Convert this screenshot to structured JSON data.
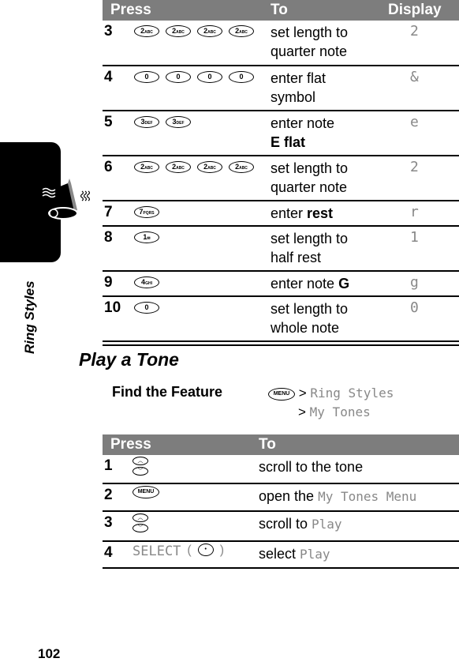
{
  "section_tab": {
    "label": "Ring Styles",
    "icon": "ringing-bell-icon"
  },
  "table1": {
    "headers": {
      "press": "Press",
      "to": "To",
      "display": "Display"
    },
    "rows": [
      {
        "step": "3",
        "keys": [
          [
            "2",
            "ABC"
          ],
          [
            "2",
            "ABC"
          ],
          [
            "2",
            "ABC"
          ],
          [
            "2",
            "ABC"
          ]
        ],
        "to_line1": "set length to",
        "to_line2": "quarter note",
        "display": "2"
      },
      {
        "step": "4",
        "keys": [
          [
            "0",
            ""
          ],
          [
            "0",
            ""
          ],
          [
            "0",
            ""
          ],
          [
            "0",
            ""
          ]
        ],
        "to_line1": "enter flat",
        "to_line2": "symbol",
        "display": "&"
      },
      {
        "step": "5",
        "keys": [
          [
            "3",
            "DEF"
          ],
          [
            "3",
            "DEF"
          ]
        ],
        "to_line1": "enter note",
        "to_line2": "E flat",
        "display": "e"
      },
      {
        "step": "6",
        "keys": [
          [
            "2",
            "ABC"
          ],
          [
            "2",
            "ABC"
          ],
          [
            "2",
            "ABC"
          ],
          [
            "2",
            "ABC"
          ]
        ],
        "to_line1": "set length to",
        "to_line2": "quarter note",
        "display": "2"
      },
      {
        "step": "7",
        "keys": [
          [
            "7",
            "PQRS"
          ]
        ],
        "to_line1": "enter ",
        "to_bold": "rest",
        "display": "r"
      },
      {
        "step": "8",
        "keys": [
          [
            "1",
            "✉"
          ]
        ],
        "to_line1": "set length to",
        "to_line2": "half rest",
        "display": "1"
      },
      {
        "step": "9",
        "keys": [
          [
            "4",
            "GHI"
          ]
        ],
        "to_line1": "enter note ",
        "to_bold": "G",
        "display": "g"
      },
      {
        "step": "10",
        "keys": [
          [
            "0",
            ""
          ]
        ],
        "to_line1": "set length to",
        "to_line2": "whole note",
        "display": "0"
      }
    ]
  },
  "section": {
    "title": "Play a Tone",
    "find_feature_label": "Find the Feature",
    "menu_key": "MENU",
    "path": [
      "Ring Styles",
      "My Tones"
    ]
  },
  "table2": {
    "headers": {
      "press": "Press",
      "to": "To"
    },
    "rows": [
      {
        "step": "1",
        "key": "scroll",
        "to": "scroll to the tone"
      },
      {
        "step": "2",
        "key": "MENU",
        "to_prefix": "open the ",
        "to_mono": "My Tones Menu"
      },
      {
        "step": "3",
        "key": "scroll",
        "to_prefix": "scroll to ",
        "to_mono": "Play"
      },
      {
        "step": "4",
        "key_text": "SELECT",
        "to_prefix": "select ",
        "to_mono": "Play"
      }
    ]
  },
  "page_number": "102"
}
